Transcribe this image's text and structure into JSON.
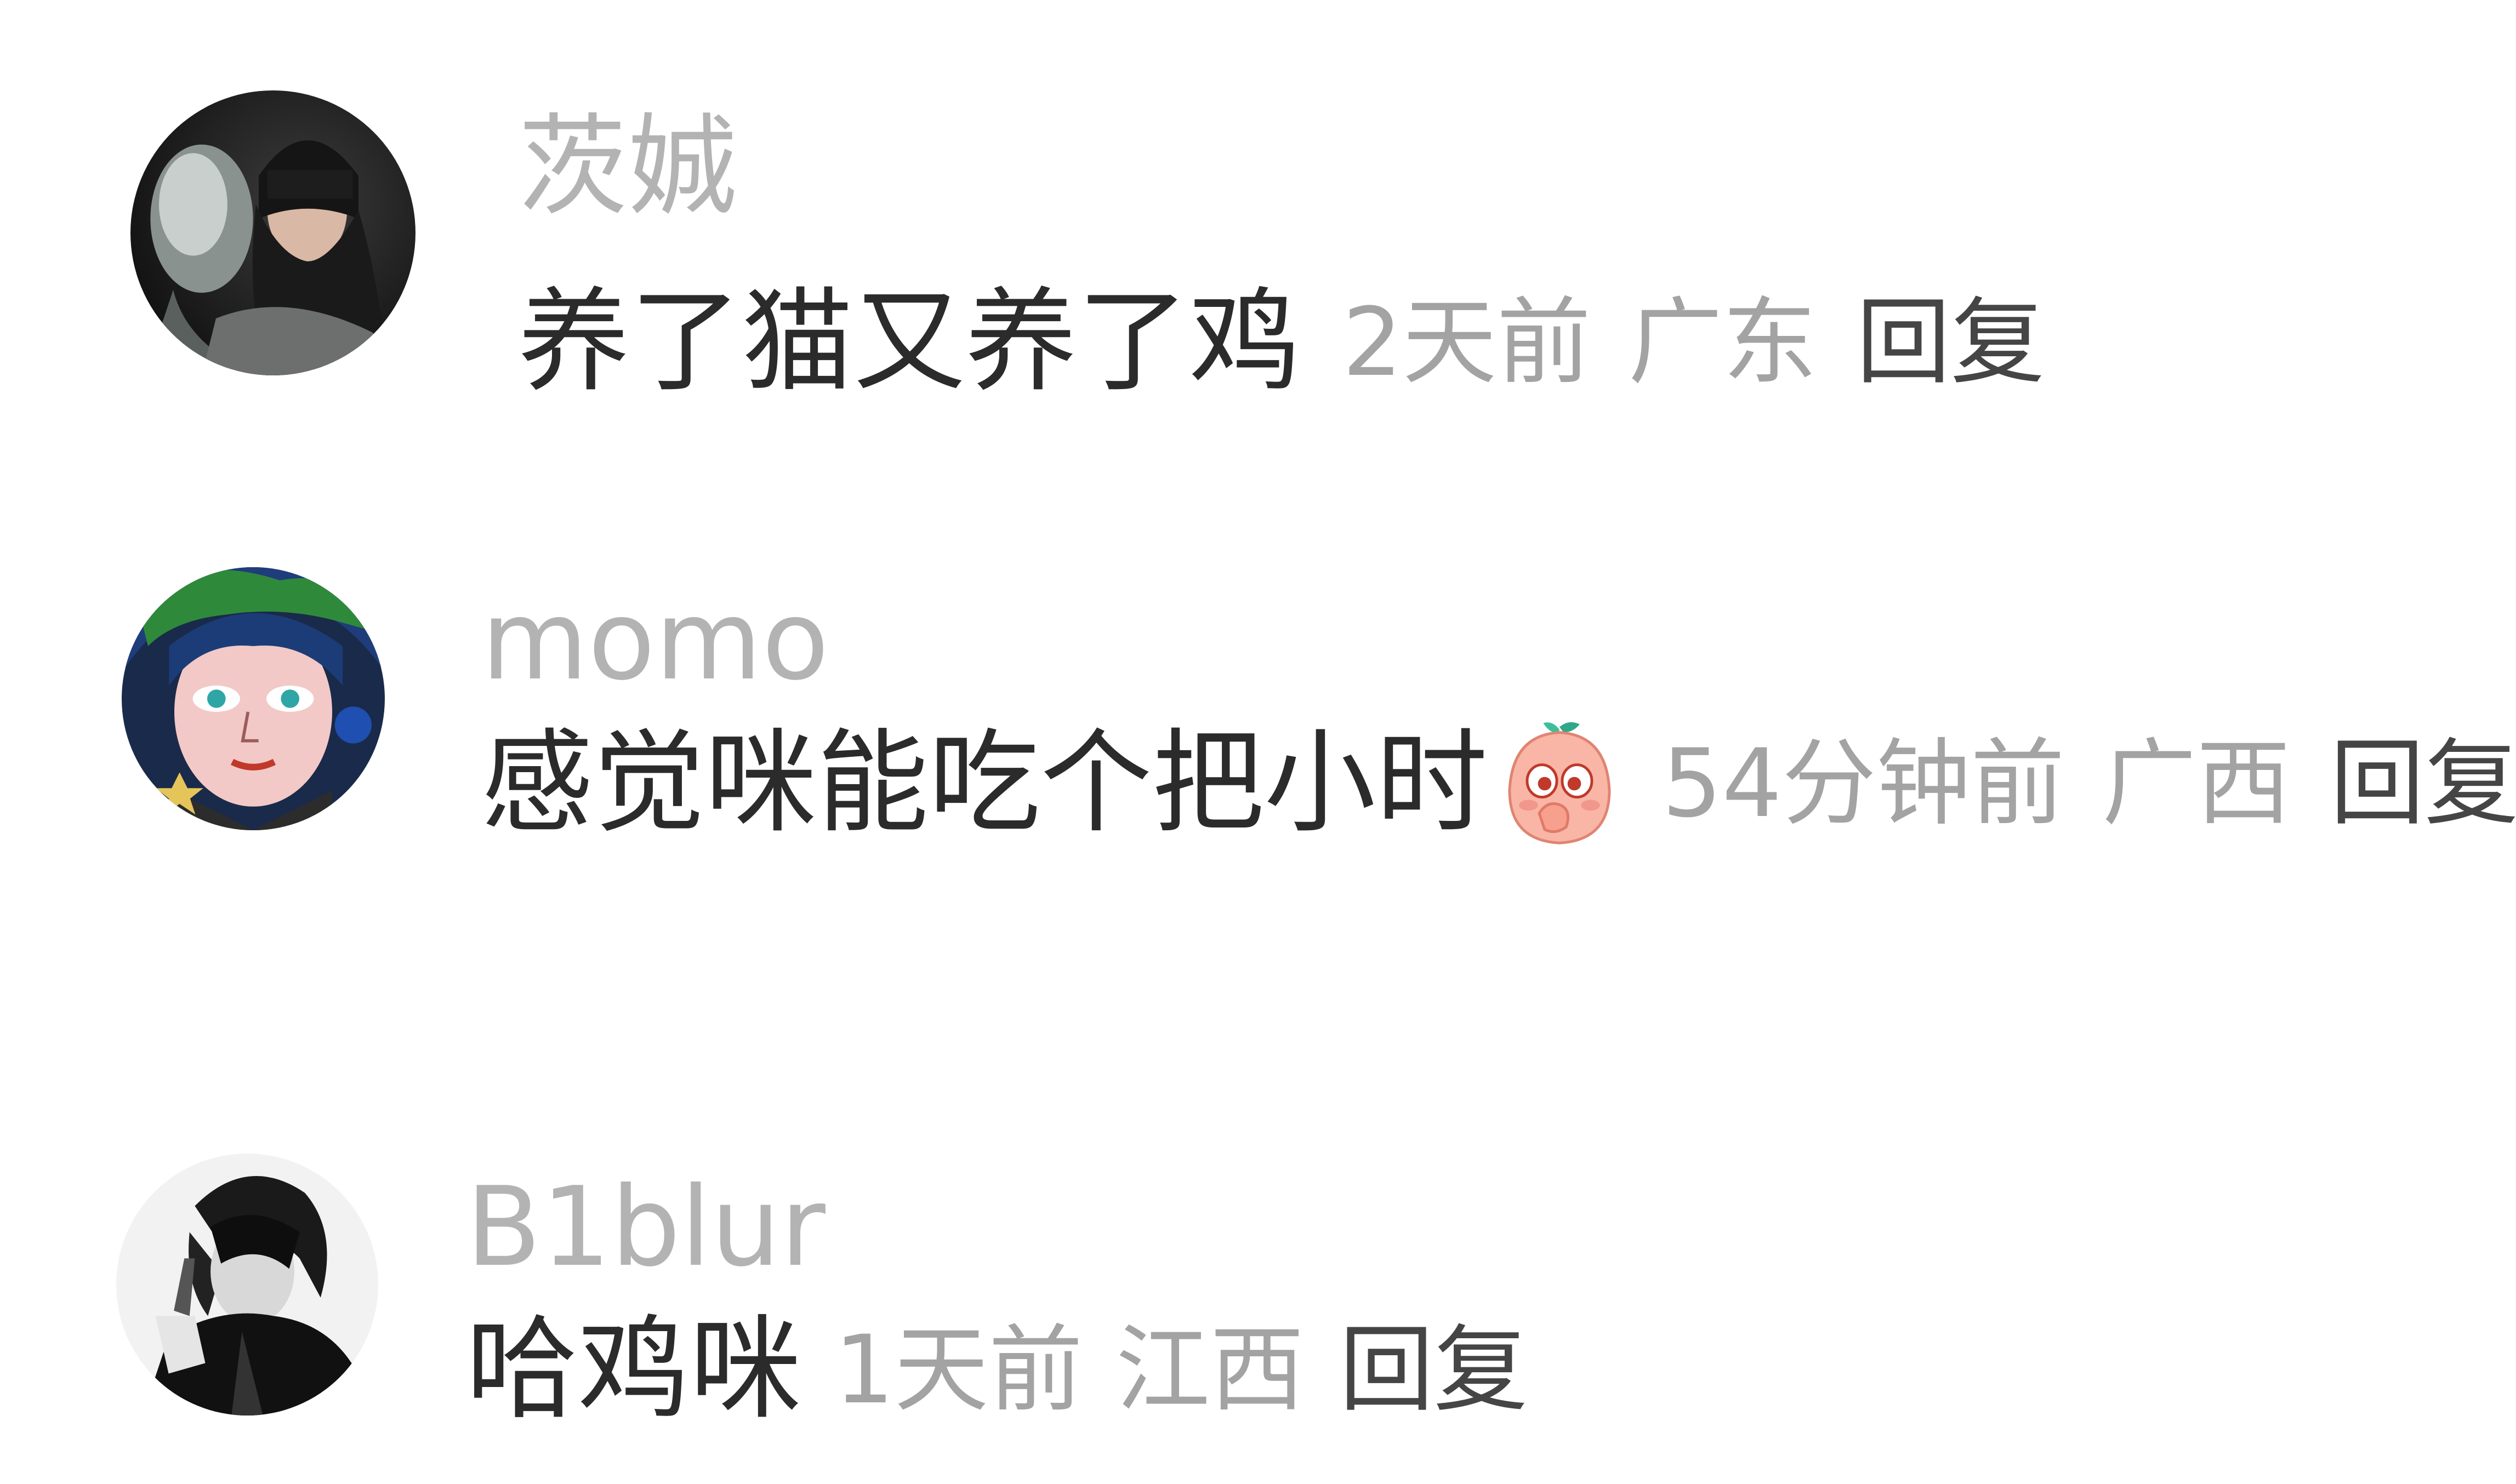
{
  "comments": [
    {
      "username": "茨娍",
      "text": "养了猫又养了鸡",
      "time": "2天前",
      "location": "广东",
      "reply_label": "回复"
    },
    {
      "username": "momo",
      "text": "感觉咪能吃个把小时",
      "emoji": "blushing-peach-emoji",
      "time": "54分钟前",
      "location": "广西",
      "reply_label": "回复"
    },
    {
      "username": "B1blur",
      "text": "哈鸡咪",
      "time": "1天前",
      "location": "江西",
      "reply_label": "回复"
    }
  ]
}
